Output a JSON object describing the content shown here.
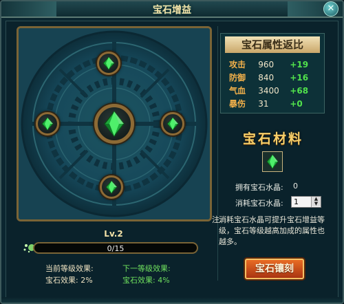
{
  "window": {
    "title": "宝石增益",
    "close_glyph": "✕"
  },
  "gem_board": {
    "center_gem": "green-gem",
    "slots": [
      "green-gem",
      "green-gem",
      "green-gem",
      "green-gem"
    ]
  },
  "attributes": {
    "title": "宝石属性返比",
    "rows": [
      {
        "name": "攻击",
        "value": "960",
        "bonus": "+19"
      },
      {
        "name": "防御",
        "value": "840",
        "bonus": "+16"
      },
      {
        "name": "气血",
        "value": "3400",
        "bonus": "+68"
      },
      {
        "name": "暴伤",
        "value": "31",
        "bonus": "+0"
      }
    ]
  },
  "material": {
    "title": "宝石材料",
    "icon": "green-gem",
    "owned_label": "拥有宝石水晶:",
    "owned_value": "0",
    "consume_label": "消耗宝石水晶:",
    "consume_value": "1"
  },
  "note": {
    "prefix": "注:",
    "text": "消耗宝石水晶可提升宝石增益等级，宝石等级越高加成的属性也越多。"
  },
  "level": {
    "label": "Lv.2",
    "progress_text": "0/15",
    "progress_fraction": 0.0
  },
  "effects": {
    "current_title": "当前等级效果:",
    "current_line": "宝石效果: 2%",
    "next_title": "下一等级效果:",
    "next_line": "宝石效果: 4%"
  },
  "actions": {
    "inlay_label": "宝石镶刻"
  },
  "colors": {
    "accent_gold": "#f6cf6a",
    "bonus_green": "#51e24c",
    "button_orange": "#e86c24"
  }
}
